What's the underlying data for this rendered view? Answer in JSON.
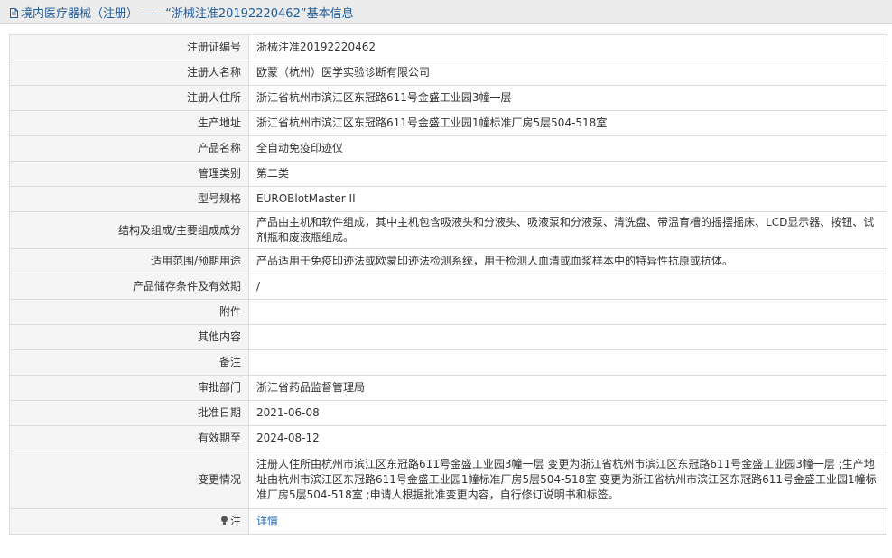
{
  "header": {
    "title": "境内医疗器械（注册） ——“浙械注准20192220462”基本信息",
    "icon": "document-icon"
  },
  "rows": [
    {
      "label": "注册证编号",
      "value": "浙械注准20192220462"
    },
    {
      "label": "注册人名称",
      "value": "欧蒙（杭州）医学实验诊断有限公司"
    },
    {
      "label": "注册人住所",
      "value": "浙江省杭州市滨江区东冠路611号金盛工业园3幢一层"
    },
    {
      "label": "生产地址",
      "value": "浙江省杭州市滨江区东冠路611号金盛工业园1幢标准厂房5层504-518室"
    },
    {
      "label": "产品名称",
      "value": "全自动免疫印迹仪"
    },
    {
      "label": "管理类别",
      "value": "第二类"
    },
    {
      "label": "型号规格",
      "value": "EUROBlotMaster II"
    },
    {
      "label": "结构及组成/主要组成成分",
      "value": "产品由主机和软件组成，其中主机包含吸液头和分液头、吸液泵和分液泵、清洗盘、带温育槽的摇摆摇床、LCD显示器、按钮、试剂瓶和废液瓶组成。"
    },
    {
      "label": "适用范围/预期用途",
      "value": "产品适用于免疫印迹法或欧蒙印迹法检测系统，用于检测人血清或血浆样本中的特异性抗原或抗体。"
    },
    {
      "label": "产品储存条件及有效期",
      "value": "/"
    },
    {
      "label": "附件",
      "value": ""
    },
    {
      "label": "其他内容",
      "value": ""
    },
    {
      "label": "备注",
      "value": ""
    },
    {
      "label": "审批部门",
      "value": "浙江省药品监督管理局"
    },
    {
      "label": "批准日期",
      "value": "2021-06-08"
    },
    {
      "label": "有效期至",
      "value": "2024-08-12"
    },
    {
      "label": "变更情况",
      "value": "注册人住所由杭州市滨江区东冠路611号金盛工业园3幢一层 变更为浙江省杭州市滨江区东冠路611号金盛工业园3幢一层 ;生产地址由杭州市滨江区东冠路611号金盛工业园1幢标准厂房5层504-518室 变更为浙江省杭州市滨江区东冠路611号金盛工业园1幢标准厂房5层504-518室 ;申请人根据批准变更内容，自行修订说明书和标签。"
    }
  ],
  "note": {
    "label": "注",
    "link": "详情",
    "icon": "lightbulb-icon"
  },
  "colors": {
    "header_text": "#1e5c9a",
    "link": "#2266aa",
    "label_bg": "#f5f5f5",
    "border": "#dcdcdc"
  }
}
